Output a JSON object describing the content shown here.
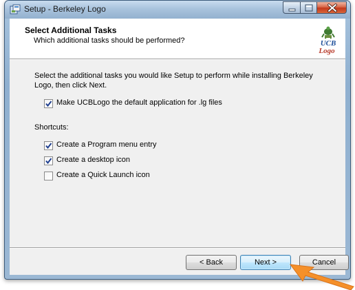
{
  "window": {
    "title": "Setup - Berkeley Logo",
    "icon": "setup-installer-icon"
  },
  "header": {
    "title": "Select Additional Tasks",
    "subtitle": "Which additional tasks should be performed?",
    "logo_text_top": "UCB",
    "logo_text_bottom": "Logo"
  },
  "content": {
    "description": "Select the additional tasks you would like Setup to perform while installing Berkeley Logo, then click Next.",
    "options": [
      {
        "label": "Make UCBLogo the default application for .lg files",
        "checked": true
      },
      {
        "label": "Create a Program menu entry",
        "checked": true
      },
      {
        "label": "Create a desktop icon",
        "checked": true
      },
      {
        "label": "Create a Quick Launch icon",
        "checked": false
      }
    ],
    "shortcuts_label": "Shortcuts:"
  },
  "buttons": {
    "back": "< Back",
    "next": "Next >",
    "cancel": "Cancel"
  },
  "colors": {
    "arrow": "#f5902a",
    "checkmark": "#1f3f8f",
    "next_border": "#3c7fb1"
  }
}
